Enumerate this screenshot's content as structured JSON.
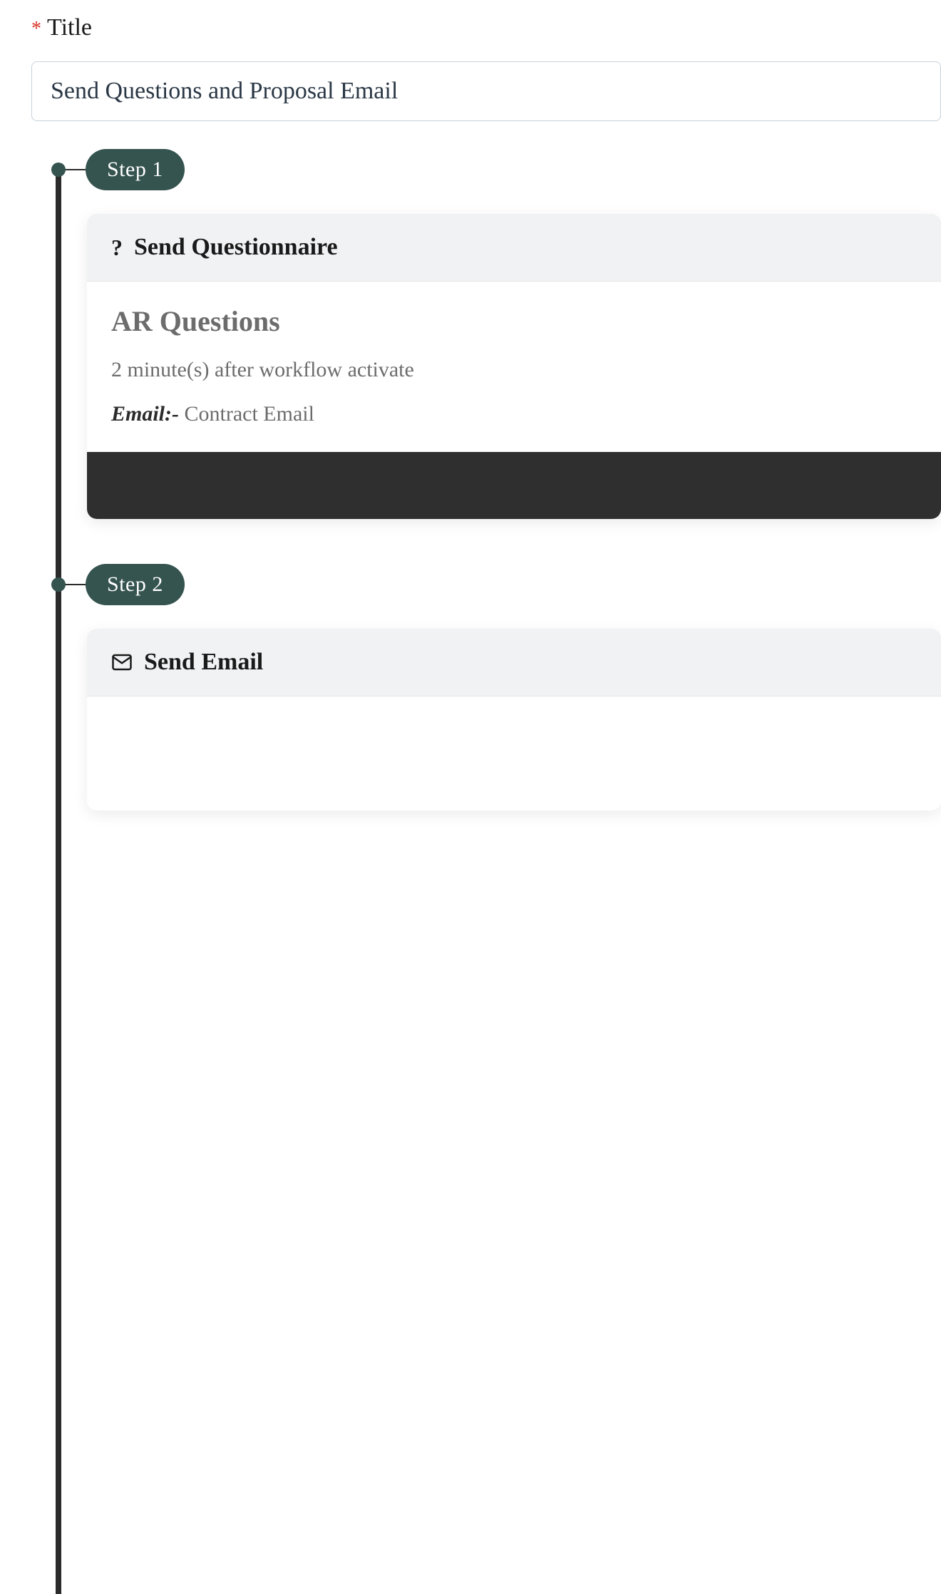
{
  "titleField": {
    "requiredMark": "*",
    "label": "Title",
    "value": "Send Questions and Proposal Email"
  },
  "steps": [
    {
      "badge": "Step 1",
      "action": {
        "iconGlyph": "?",
        "title": "Send Questionnaire"
      },
      "subject": "AR Questions",
      "delayText": "2 minute(s) after workflow activate",
      "email": {
        "label": "Email:-",
        "value": " Contract Email"
      }
    },
    {
      "badge": "Step 2",
      "action": {
        "title": "Send Email"
      }
    }
  ]
}
